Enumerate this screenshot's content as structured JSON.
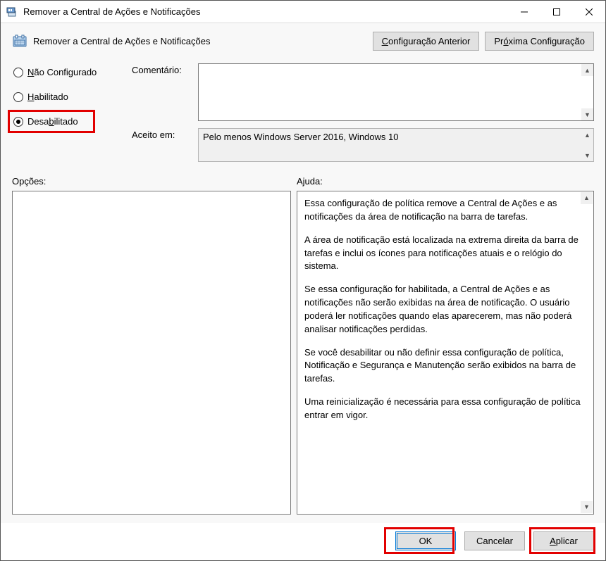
{
  "window": {
    "title": "Remover a Central de Ações e Notificações"
  },
  "header": {
    "policy_title": "Remover a Central de Ações e Notificações",
    "prev_btn": "Configuração Anterior",
    "next_btn": "Próxima Configuração"
  },
  "state_radios": {
    "not_configured": "Não Configurado",
    "not_configured_accesskey": "N",
    "enabled": "Habilitado",
    "enabled_accesskey": "H",
    "disabled": "Desabilitado",
    "disabled_accesskey": "b",
    "selected": "disabled"
  },
  "fields": {
    "comment_label": "Comentário:",
    "comment_value": "",
    "supported_label": "Aceito em:",
    "supported_value": "Pelo menos Windows Server 2016, Windows 10"
  },
  "sections": {
    "options_label": "Opções:",
    "help_label": "Ajuda:"
  },
  "help_paragraphs": [
    "Essa configuração de política remove a Central de Ações e as notificações da área de notificação na barra de tarefas.",
    "A área de notificação está localizada na extrema direita da barra de tarefas e inclui os ícones para notificações atuais e o relógio do sistema.",
    "Se essa configuração for habilitada, a Central de Ações e as notificações não serão exibidas na área de notificação. O usuário poderá ler notificações quando elas aparecerem, mas não poderá analisar notificações perdidas.",
    "Se você desabilitar ou não definir essa configuração de política, Notificação e Segurança e Manutenção serão exibidos na barra de tarefas.",
    "Uma reinicialização é necessária para essa configuração de política entrar em vigor."
  ],
  "footer": {
    "ok": "OK",
    "cancel": "Cancelar",
    "apply": "Aplicar",
    "apply_accesskey": "A"
  }
}
